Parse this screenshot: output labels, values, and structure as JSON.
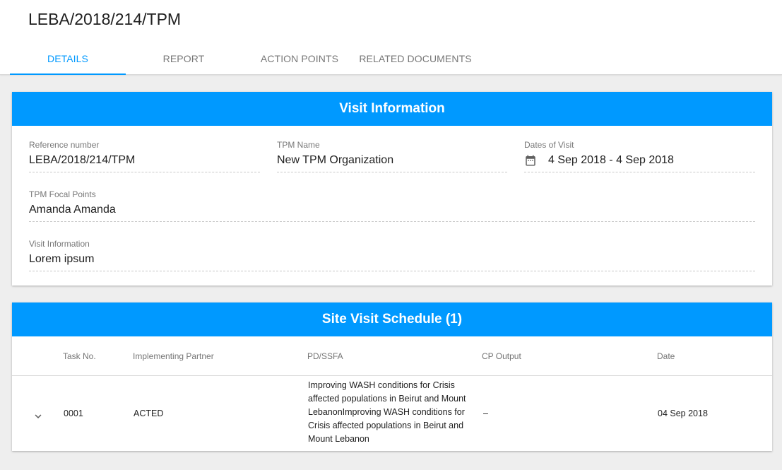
{
  "header": {
    "title": "LEBA/2018/214/TPM",
    "tabs": [
      "DETAILS",
      "REPORT",
      "ACTION POINTS",
      "RELATED DOCUMENTS"
    ]
  },
  "visit_info": {
    "title": "Visit Information",
    "reference_label": "Reference number",
    "reference_value": "LEBA/2018/214/TPM",
    "tpm_name_label": "TPM Name",
    "tpm_name_value": "New TPM Organization",
    "dates_label": "Dates of Visit",
    "dates_value": "4 Sep 2018 - 4 Sep 2018",
    "focal_label": "TPM Focal Points",
    "focal_value": "Amanda Amanda",
    "info_label": "Visit Information",
    "info_value": "Lorem ipsum"
  },
  "schedule": {
    "title": "Site Visit Schedule (1)",
    "columns": [
      "Task No.",
      "Implementing Partner",
      "PD/SSFA",
      "CP Output",
      "Date"
    ],
    "rows": [
      {
        "task_no": "0001",
        "partner": "ACTED",
        "pd_ssfa": "Improving WASH conditions for Crisis affected populations in Beirut and Mount LebanonImproving WASH conditions for Crisis affected populations in Beirut and Mount Lebanon",
        "cp_output": "–",
        "date": "04 Sep 2018"
      }
    ]
  },
  "colors": {
    "accent": "#0099ff",
    "background": "#eeeeee"
  },
  "icons": {
    "dates": "calendar-icon",
    "expand": "chevron-down-icon"
  }
}
